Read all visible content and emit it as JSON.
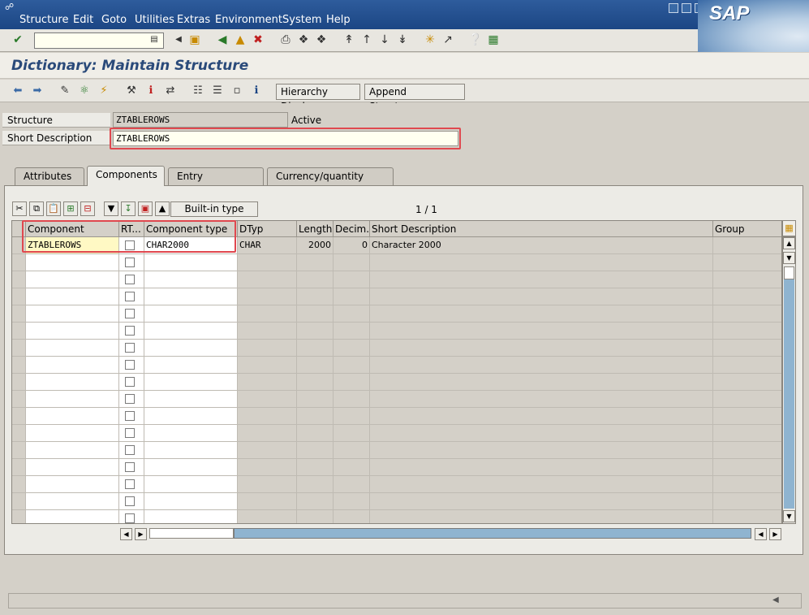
{
  "menu": {
    "items": [
      "Structure",
      "Edit",
      "Goto",
      "Utilities",
      "Extras",
      "Environment",
      "System",
      "Help"
    ],
    "logo": "SAP"
  },
  "toolbar": {
    "command_value": ""
  },
  "title": "Dictionary: Maintain Structure",
  "app_toolbar": {
    "hierarchy_label": "Hierarchy Display",
    "append_label": "Append Structure..."
  },
  "header_fields": {
    "structure_label": "Structure",
    "structure_value": "ZTABLEROWS",
    "status": "Active",
    "short_desc_label": "Short Description",
    "short_desc_value": "ZTABLEROWS"
  },
  "tabs": [
    "Attributes",
    "Components",
    "Entry help/check",
    "Currency/quantity fields"
  ],
  "active_tab": "Components",
  "table_toolbar": {
    "builtin_label": "Built-in type",
    "page_indicator": "1 / 1"
  },
  "table": {
    "headers": [
      "Component",
      "RT...",
      "Component type",
      "DTyp",
      "Length",
      "Decim...",
      "Short Description",
      "Group"
    ],
    "rows": [
      [
        "ZTABLEROWS",
        "",
        "CHAR2000",
        "CHAR",
        "2000",
        "0",
        "Character 2000",
        ""
      ]
    ],
    "empty_rows": 16
  },
  "colors": {
    "menubar": "#1c4684",
    "highlight_red": "#e0484f",
    "selected_field": "#fff9c4"
  }
}
